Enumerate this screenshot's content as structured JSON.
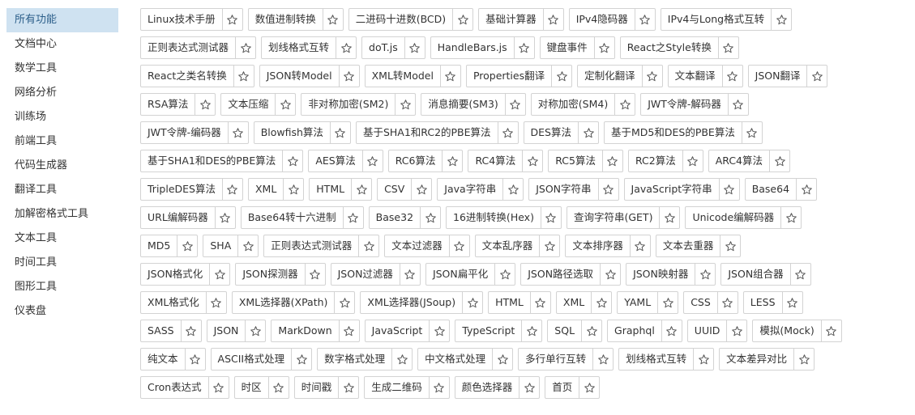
{
  "sidebar": {
    "active_index": 0,
    "items": [
      {
        "label": "所有功能"
      },
      {
        "label": "文档中心"
      },
      {
        "label": "数学工具"
      },
      {
        "label": "网络分析"
      },
      {
        "label": "训练场"
      },
      {
        "label": "前端工具"
      },
      {
        "label": "代码生成器"
      },
      {
        "label": "翻译工具"
      },
      {
        "label": "加解密格式工具"
      },
      {
        "label": "文本工具"
      },
      {
        "label": "时间工具"
      },
      {
        "label": "图形工具"
      },
      {
        "label": "仪表盘"
      }
    ]
  },
  "star_icon": "star-outline-icon",
  "tool_rows": [
    [
      "Linux技术手册",
      "数值进制转换",
      "二进码十进数(BCD)",
      "基础计算器",
      "IPv4隐码器",
      "IPv4与Long格式互转"
    ],
    [
      "正则表达式测试器",
      "划线格式互转",
      "doT.js",
      "HandleBars.js",
      "键盘事件",
      "React之Style转换"
    ],
    [
      "React之类名转换",
      "JSON转Model",
      "XML转Model",
      "Properties翻译",
      "定制化翻译",
      "文本翻译",
      "JSON翻译"
    ],
    [
      "RSA算法",
      "文本压缩",
      "非对称加密(SM2)",
      "消息摘要(SM3)",
      "对称加密(SM4)",
      "JWT令牌-解码器"
    ],
    [
      "JWT令牌-编码器",
      "Blowfish算法",
      "基于SHA1和RC2的PBE算法",
      "DES算法",
      "基于MD5和DES的PBE算法"
    ],
    [
      "基于SHA1和DES的PBE算法",
      "AES算法",
      "RC6算法",
      "RC4算法",
      "RC5算法",
      "RC2算法",
      "ARC4算法"
    ],
    [
      "TripleDES算法",
      "XML",
      "HTML",
      "CSV",
      "Java字符串",
      "JSON字符串",
      "JavaScript字符串",
      "Base64"
    ],
    [
      "URL编解码器",
      "Base64转十六进制",
      "Base32",
      "16进制转换(Hex)",
      "查询字符串(GET)",
      "Unicode编解码器"
    ],
    [
      "MD5",
      "SHA",
      "正则表达式测试器",
      "文本过滤器",
      "文本乱序器",
      "文本排序器",
      "文本去重器"
    ],
    [
      "JSON格式化",
      "JSON探测器",
      "JSON过滤器",
      "JSON扁平化",
      "JSON路径选取",
      "JSON映射器",
      "JSON组合器"
    ],
    [
      "XML格式化",
      "XML选择器(XPath)",
      "XML选择器(JSoup)",
      "HTML",
      "XML",
      "YAML",
      "CSS",
      "LESS"
    ],
    [
      "SASS",
      "JSON",
      "MarkDown",
      "JavaScript",
      "TypeScript",
      "SQL",
      "Graphql",
      "UUID",
      "模拟(Mock)"
    ],
    [
      "纯文本",
      "ASCII格式处理",
      "数字格式处理",
      "中文格式处理",
      "多行单行互转",
      "划线格式互转",
      "文本差异对比"
    ],
    [
      "Cron表达式",
      "时区",
      "时间戳",
      "生成二维码",
      "颜色选择器",
      "首页"
    ]
  ]
}
